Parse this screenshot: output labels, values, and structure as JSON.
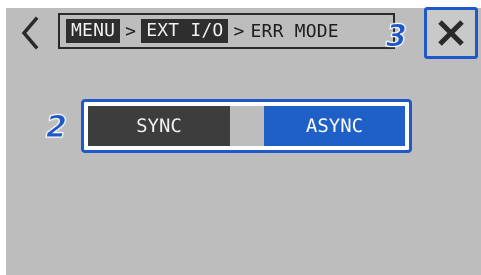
{
  "header": {
    "back_icon": "chevron-left-icon",
    "breadcrumb": [
      {
        "label": "MENU",
        "highlighted": true
      },
      {
        "label": "EXT I/O",
        "highlighted": true
      },
      {
        "label": "ERR MODE",
        "highlighted": false
      }
    ],
    "separator": ">",
    "close_icon": "close-x-icon"
  },
  "callouts": {
    "close": "3",
    "toggle": "2"
  },
  "mode_toggle": {
    "options": [
      "SYNC",
      "ASYNC"
    ],
    "selected": "ASYNC"
  },
  "colors": {
    "screen_bg": "#bdbdbd",
    "accent": "#1f58c9",
    "selected": "#1f60c6",
    "unselected": "#3d3d3d"
  }
}
